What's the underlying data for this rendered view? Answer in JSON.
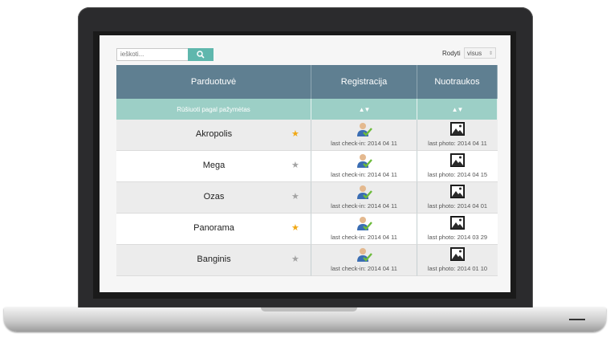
{
  "search": {
    "placeholder": "ieškoti..."
  },
  "filter": {
    "label": "Rodyti",
    "value": "visus"
  },
  "table": {
    "headers": {
      "store": "Parduotuvė",
      "registration": "Registracija",
      "photos": "Nuotraukos"
    },
    "sort_label": "Rūšiuoti pagal pažymėtas",
    "sort_arrows": "▲▼",
    "rows": [
      {
        "store": "Akropolis",
        "favorite": true,
        "checkin": "last check-in: 2014 04 11",
        "photo": "last photo: 2014 04 11"
      },
      {
        "store": "Mega",
        "favorite": false,
        "checkin": "last check-in: 2014 04 11",
        "photo": "last photo: 2014 04 15"
      },
      {
        "store": "Ozas",
        "favorite": false,
        "checkin": "last check-in: 2014 04 11",
        "photo": "last photo: 2014 04 01"
      },
      {
        "store": "Panorama",
        "favorite": true,
        "checkin": "last check-in: 2014 04 11",
        "photo": "last photo: 2014 03 29"
      },
      {
        "store": "Banginis",
        "favorite": false,
        "checkin": "last check-in: 2014 04 11",
        "photo": "last photo: 2014 01 10"
      }
    ]
  },
  "colors": {
    "header_bg": "#5f7f91",
    "subheader_bg": "#9ccfc6",
    "accent": "#5fb7ad",
    "star_active": "#f1a814",
    "star_inactive": "#a3a3a3"
  },
  "icons": {
    "search": "search-icon",
    "checkin": "user-check-icon",
    "photo": "image-icon",
    "favorite": "star-icon"
  }
}
